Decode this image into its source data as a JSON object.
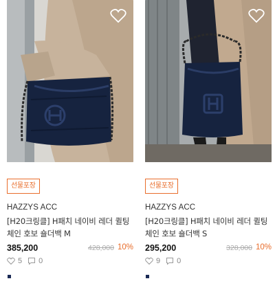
{
  "colors": {
    "accent": "#e86c2a",
    "strike": "#aaaaaa",
    "bag_navy": "#16233f",
    "coat_beige": "#c7b39c"
  },
  "products": [
    {
      "badge": "선물포장",
      "brand": "HAZZYS ACC",
      "name": "[H20크링클] H패치 네이비 레더 퀼팅 체인 호보 숄더백 M",
      "price": "385,200",
      "original_price": "428,000",
      "discount": "10%",
      "likes": "5",
      "reviews": "0",
      "icons": {
        "wishlist": "heart-outline-icon",
        "like": "heart-icon",
        "review": "comment-icon"
      }
    },
    {
      "badge": "선물포장",
      "brand": "HAZZYS ACC",
      "name": "[H20크링클] H패치 네이비 레더 퀼팅 체인 호보 숄더백 S",
      "price": "295,200",
      "original_price": "328,000",
      "discount": "10%",
      "likes": "9",
      "reviews": "0",
      "icons": {
        "wishlist": "heart-outline-icon",
        "like": "heart-icon",
        "review": "comment-icon"
      }
    }
  ]
}
